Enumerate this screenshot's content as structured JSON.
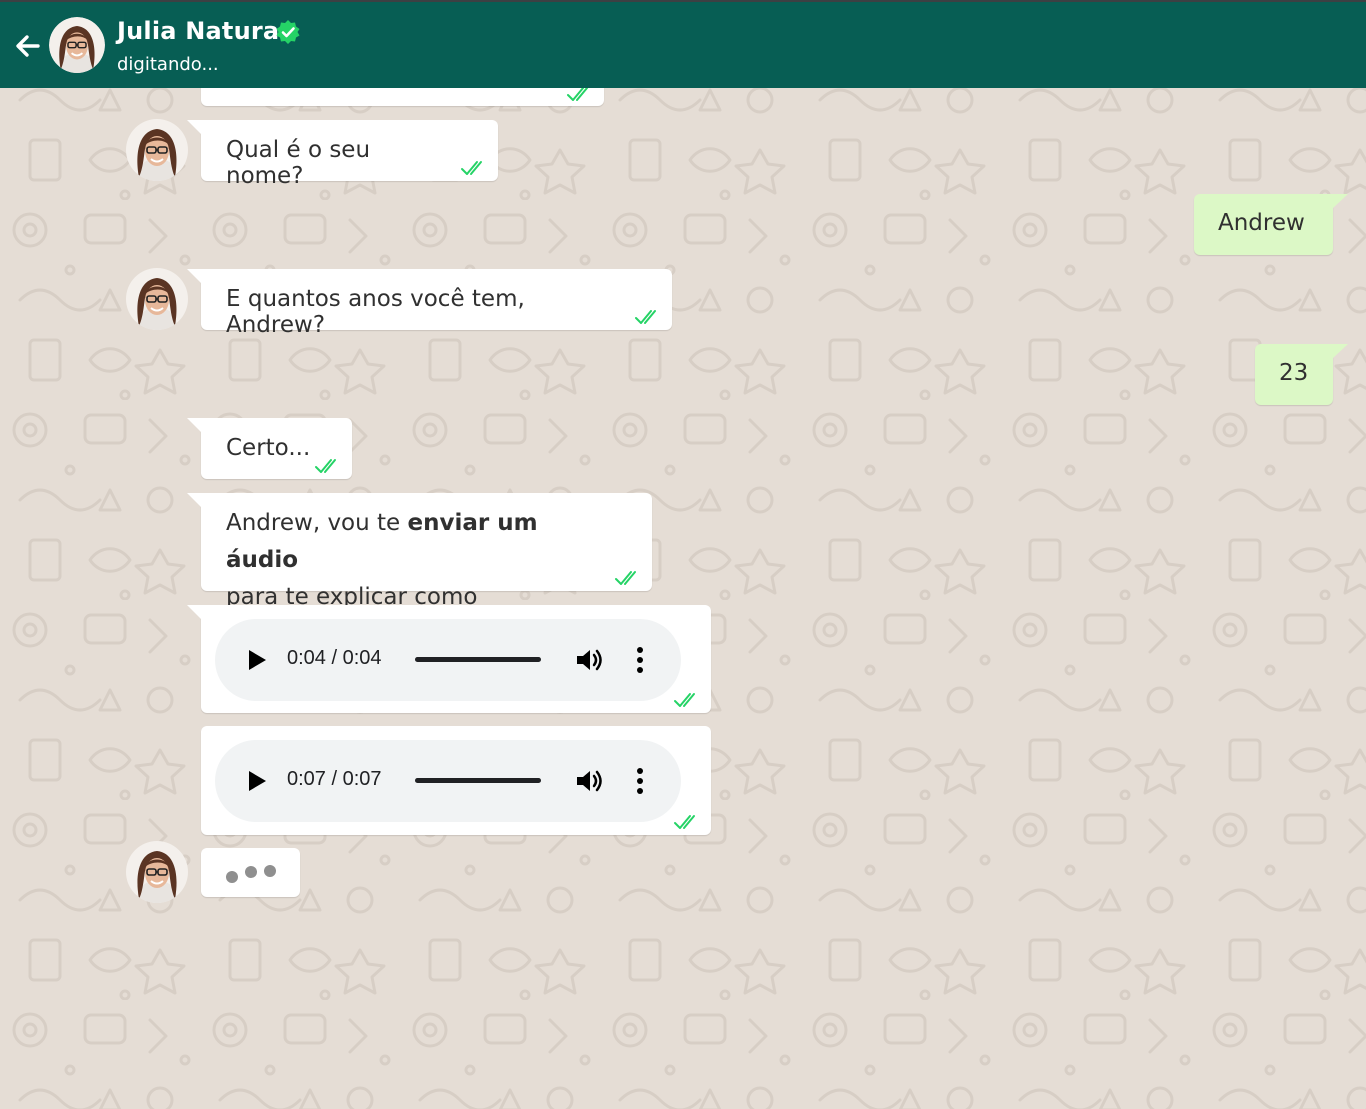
{
  "header": {
    "contact_name": "Julia Natura",
    "status": "digitando...",
    "bg_color": "#075e54"
  },
  "messages": [
    {
      "direction": "in",
      "text": "Qual é o seu nome?",
      "status": "read"
    },
    {
      "direction": "out",
      "text": "Andrew"
    },
    {
      "direction": "in",
      "text": "E quantos anos você tem, Andrew?",
      "status": "read"
    },
    {
      "direction": "out",
      "text": "23"
    },
    {
      "direction": "in",
      "text": "Certo...",
      "status": "read"
    },
    {
      "direction": "in",
      "text_before": "Andrew, vou te ",
      "text_bold": "enviar um áudio",
      "text_after": "para te explicar como funciona...",
      "status": "read"
    }
  ],
  "audios": [
    {
      "time": "0:04 / 0:04",
      "progress": 1.0
    },
    {
      "time": "0:07 / 0:07",
      "progress": 1.0
    }
  ],
  "colors": {
    "chat_bg": "#e5ddd5",
    "incoming_bubble": "#ffffff",
    "outgoing_bubble": "#dcf8c6",
    "read_tick": "#25d366"
  },
  "icons": {
    "back": "arrow-left-icon",
    "verified": "verified-badge-icon",
    "ticks": "double-check-icon",
    "play": "play-icon",
    "volume": "volume-icon",
    "more": "more-vertical-icon"
  }
}
